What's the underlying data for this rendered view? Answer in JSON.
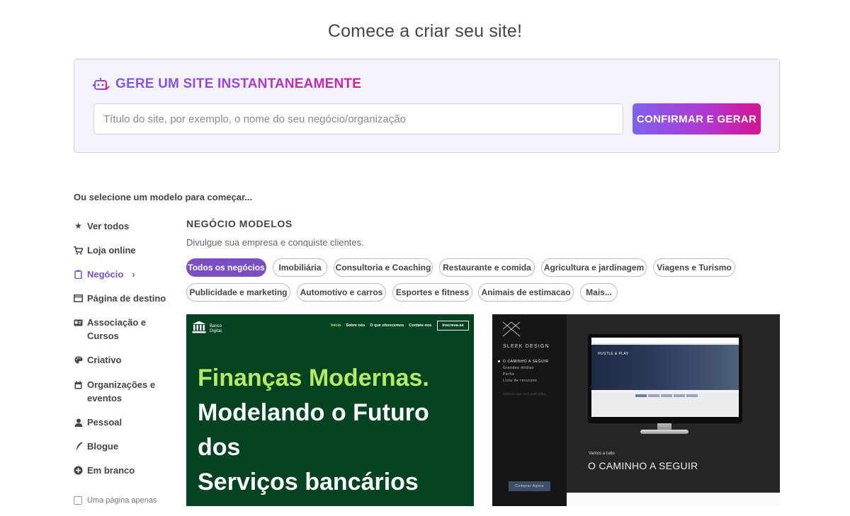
{
  "page": {
    "title": "Comece a criar seu site!"
  },
  "generator": {
    "title": "GERE UM SITE INSTANTANEAMENTE",
    "input_placeholder": "Título do site, por exemplo, o nome do seu negócio/organização",
    "button_label": "CONFIRMAR E GERAR"
  },
  "select_label": "Ou selecione um modelo para começar...",
  "sidebar": {
    "items": [
      {
        "label": "Ver todos",
        "icon": "star-icon"
      },
      {
        "label": "Loja online",
        "icon": "cart-icon"
      },
      {
        "label": "Negócio",
        "icon": "clipboard-icon",
        "active": true
      },
      {
        "label": "Página de destino",
        "icon": "window-icon"
      },
      {
        "label": "Associação e Cursos",
        "icon": "id-card-icon"
      },
      {
        "label": "Criativo",
        "icon": "palette-icon"
      },
      {
        "label": "Organizações e eventos",
        "icon": "calendar-icon"
      },
      {
        "label": "Pessoal",
        "icon": "user-icon"
      },
      {
        "label": "Blogue",
        "icon": "pen-icon"
      },
      {
        "label": "Em branco",
        "icon": "plus-circle-icon"
      }
    ],
    "one_page_label": "Uma página apenas"
  },
  "category": {
    "title": "NEGÓCIO MODELOS",
    "description": "Divulgue sua empresa e conquiste clientes.",
    "chips": [
      "Todos os negócios",
      "Imobiliária",
      "Consultoria e Coaching",
      "Restaurante e comida",
      "Agricultura e jardinagem",
      "Viagens e Turismo",
      "Publicidade e marketing",
      "Automotivo e carros",
      "Esportes e fitness",
      "Animais de estimacao",
      "Mais..."
    ]
  },
  "templates": {
    "bank": {
      "logo_line1": "Banco",
      "logo_line2": "Digital.",
      "nav": [
        "Início",
        "Sobre nós",
        "O que oferecemos",
        "Contate-nos"
      ],
      "cta": "Inscreva-se",
      "headline_1": "Finanças Modernas.",
      "headline_2": "Modelando o Futuro",
      "headline_3": "dos",
      "headline_4": "Serviços bancários",
      "accent": "#b7ea64",
      "background": "#034322"
    },
    "sleek": {
      "brand": "SLEEK DESIGN",
      "menu": [
        "O CAMINHO A SEGUIR",
        "Grandes mídias",
        "Perfis",
        "Lista de recursos"
      ],
      "tagline": "Subtítulo que você pode editar",
      "screen_text": "HUSTLE & PLAY",
      "buy_label": "Comprar Agora",
      "small_text": "Vamos a tudo",
      "big_text": "O CAMINHO A SEGUIR"
    }
  }
}
